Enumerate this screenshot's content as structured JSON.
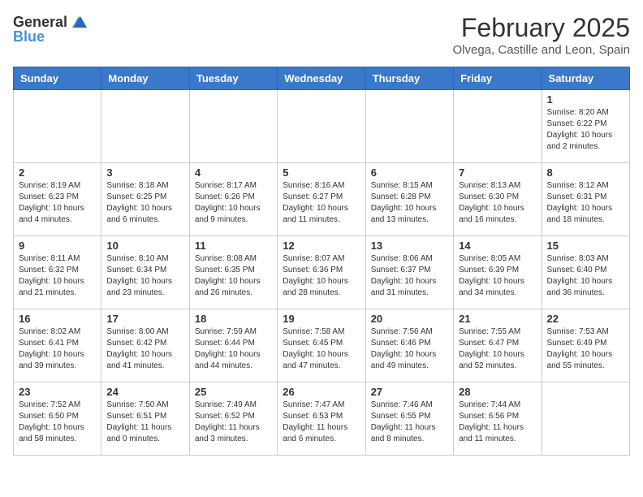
{
  "header": {
    "logo_general": "General",
    "logo_blue": "Blue",
    "month_title": "February 2025",
    "location": "Olvega, Castille and Leon, Spain"
  },
  "days_of_week": [
    "Sunday",
    "Monday",
    "Tuesday",
    "Wednesday",
    "Thursday",
    "Friday",
    "Saturday"
  ],
  "weeks": [
    [
      {
        "day": "",
        "info": ""
      },
      {
        "day": "",
        "info": ""
      },
      {
        "day": "",
        "info": ""
      },
      {
        "day": "",
        "info": ""
      },
      {
        "day": "",
        "info": ""
      },
      {
        "day": "",
        "info": ""
      },
      {
        "day": "1",
        "info": "Sunrise: 8:20 AM\nSunset: 6:22 PM\nDaylight: 10 hours and 2 minutes."
      }
    ],
    [
      {
        "day": "2",
        "info": "Sunrise: 8:19 AM\nSunset: 6:23 PM\nDaylight: 10 hours and 4 minutes."
      },
      {
        "day": "3",
        "info": "Sunrise: 8:18 AM\nSunset: 6:25 PM\nDaylight: 10 hours and 6 minutes."
      },
      {
        "day": "4",
        "info": "Sunrise: 8:17 AM\nSunset: 6:26 PM\nDaylight: 10 hours and 9 minutes."
      },
      {
        "day": "5",
        "info": "Sunrise: 8:16 AM\nSunset: 6:27 PM\nDaylight: 10 hours and 11 minutes."
      },
      {
        "day": "6",
        "info": "Sunrise: 8:15 AM\nSunset: 6:28 PM\nDaylight: 10 hours and 13 minutes."
      },
      {
        "day": "7",
        "info": "Sunrise: 8:13 AM\nSunset: 6:30 PM\nDaylight: 10 hours and 16 minutes."
      },
      {
        "day": "8",
        "info": "Sunrise: 8:12 AM\nSunset: 6:31 PM\nDaylight: 10 hours and 18 minutes."
      }
    ],
    [
      {
        "day": "9",
        "info": "Sunrise: 8:11 AM\nSunset: 6:32 PM\nDaylight: 10 hours and 21 minutes."
      },
      {
        "day": "10",
        "info": "Sunrise: 8:10 AM\nSunset: 6:34 PM\nDaylight: 10 hours and 23 minutes."
      },
      {
        "day": "11",
        "info": "Sunrise: 8:08 AM\nSunset: 6:35 PM\nDaylight: 10 hours and 26 minutes."
      },
      {
        "day": "12",
        "info": "Sunrise: 8:07 AM\nSunset: 6:36 PM\nDaylight: 10 hours and 28 minutes."
      },
      {
        "day": "13",
        "info": "Sunrise: 8:06 AM\nSunset: 6:37 PM\nDaylight: 10 hours and 31 minutes."
      },
      {
        "day": "14",
        "info": "Sunrise: 8:05 AM\nSunset: 6:39 PM\nDaylight: 10 hours and 34 minutes."
      },
      {
        "day": "15",
        "info": "Sunrise: 8:03 AM\nSunset: 6:40 PM\nDaylight: 10 hours and 36 minutes."
      }
    ],
    [
      {
        "day": "16",
        "info": "Sunrise: 8:02 AM\nSunset: 6:41 PM\nDaylight: 10 hours and 39 minutes."
      },
      {
        "day": "17",
        "info": "Sunrise: 8:00 AM\nSunset: 6:42 PM\nDaylight: 10 hours and 41 minutes."
      },
      {
        "day": "18",
        "info": "Sunrise: 7:59 AM\nSunset: 6:44 PM\nDaylight: 10 hours and 44 minutes."
      },
      {
        "day": "19",
        "info": "Sunrise: 7:58 AM\nSunset: 6:45 PM\nDaylight: 10 hours and 47 minutes."
      },
      {
        "day": "20",
        "info": "Sunrise: 7:56 AM\nSunset: 6:46 PM\nDaylight: 10 hours and 49 minutes."
      },
      {
        "day": "21",
        "info": "Sunrise: 7:55 AM\nSunset: 6:47 PM\nDaylight: 10 hours and 52 minutes."
      },
      {
        "day": "22",
        "info": "Sunrise: 7:53 AM\nSunset: 6:49 PM\nDaylight: 10 hours and 55 minutes."
      }
    ],
    [
      {
        "day": "23",
        "info": "Sunrise: 7:52 AM\nSunset: 6:50 PM\nDaylight: 10 hours and 58 minutes."
      },
      {
        "day": "24",
        "info": "Sunrise: 7:50 AM\nSunset: 6:51 PM\nDaylight: 11 hours and 0 minutes."
      },
      {
        "day": "25",
        "info": "Sunrise: 7:49 AM\nSunset: 6:52 PM\nDaylight: 11 hours and 3 minutes."
      },
      {
        "day": "26",
        "info": "Sunrise: 7:47 AM\nSunset: 6:53 PM\nDaylight: 11 hours and 6 minutes."
      },
      {
        "day": "27",
        "info": "Sunrise: 7:46 AM\nSunset: 6:55 PM\nDaylight: 11 hours and 8 minutes."
      },
      {
        "day": "28",
        "info": "Sunrise: 7:44 AM\nSunset: 6:56 PM\nDaylight: 11 hours and 11 minutes."
      },
      {
        "day": "",
        "info": ""
      }
    ]
  ]
}
